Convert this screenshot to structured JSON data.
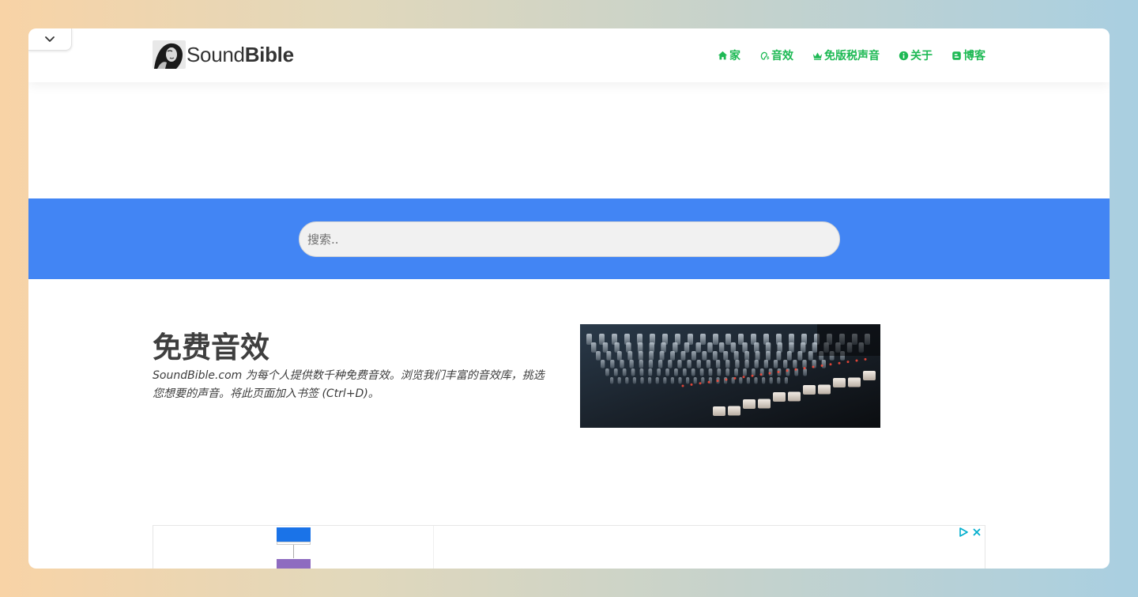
{
  "brand": {
    "logo_regular": "Sound",
    "logo_bold": "Bible"
  },
  "nav": [
    {
      "label": "家",
      "icon": "home-icon"
    },
    {
      "label": "音效",
      "icon": "sound-wave-icon"
    },
    {
      "label": "免版税声音",
      "icon": "crown-icon"
    },
    {
      "label": "关于",
      "icon": "info-icon"
    },
    {
      "label": "博客",
      "icon": "blog-icon"
    }
  ],
  "search": {
    "placeholder": "搜索.."
  },
  "intro": {
    "title": "免费音效",
    "text": "SoundBible.com 为每个人提供数千种免费音效。浏览我们丰富的音效库，挑选您想要的声音。将此页面加入书签 (Ctrl+D)。"
  },
  "colors": {
    "accent": "#1db954",
    "band": "#4285f4"
  }
}
